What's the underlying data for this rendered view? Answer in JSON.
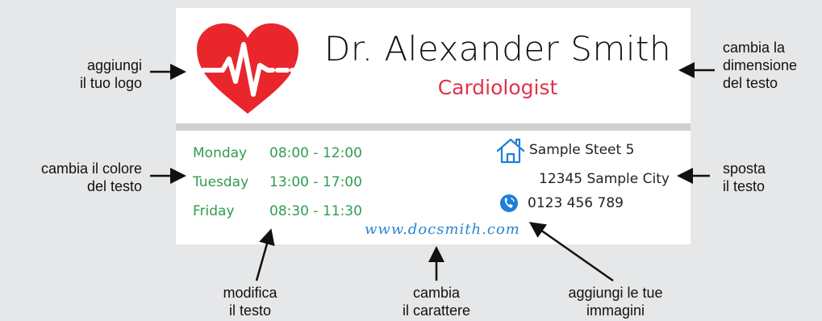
{
  "card": {
    "doctor_name": "Dr. Alexander Smith",
    "specialty": "Cardiologist",
    "logo_icon": "heart-ecg-icon",
    "hours": [
      {
        "day": "Monday",
        "time": "08:00 - 12:00"
      },
      {
        "day": "Tuesday",
        "time": "13:00 - 17:00"
      },
      {
        "day": "Friday",
        "time": "08:30 - 11:30"
      }
    ],
    "address": {
      "street": "Sample Steet 5",
      "city": "12345 Sample City",
      "phone": "0123 456 789",
      "home_icon": "house-icon",
      "phone_icon": "phone-icon"
    },
    "website": "www.docsmith.com",
    "colors": {
      "heart": "#e8262c",
      "specialty": "#e0334a",
      "hours": "#2e9e4e",
      "website": "#2b84d4",
      "icons": "#1f7fd6"
    }
  },
  "annotations": {
    "add_logo": {
      "line1": "aggiungi",
      "line2": "il tuo logo"
    },
    "resize_text": {
      "line1": "cambia la",
      "line2": "dimensione",
      "line3": "del testo"
    },
    "change_color": {
      "line1": "cambia il colore",
      "line2": "del testo"
    },
    "move_text": {
      "line1": "sposta",
      "line2": "il testo"
    },
    "edit_text": {
      "line1": "modifica",
      "line2": "il testo"
    },
    "change_font": {
      "line1": "cambia",
      "line2": "il carattere"
    },
    "add_images": {
      "line1": "aggiungi le tue",
      "line2": "immagini"
    }
  }
}
